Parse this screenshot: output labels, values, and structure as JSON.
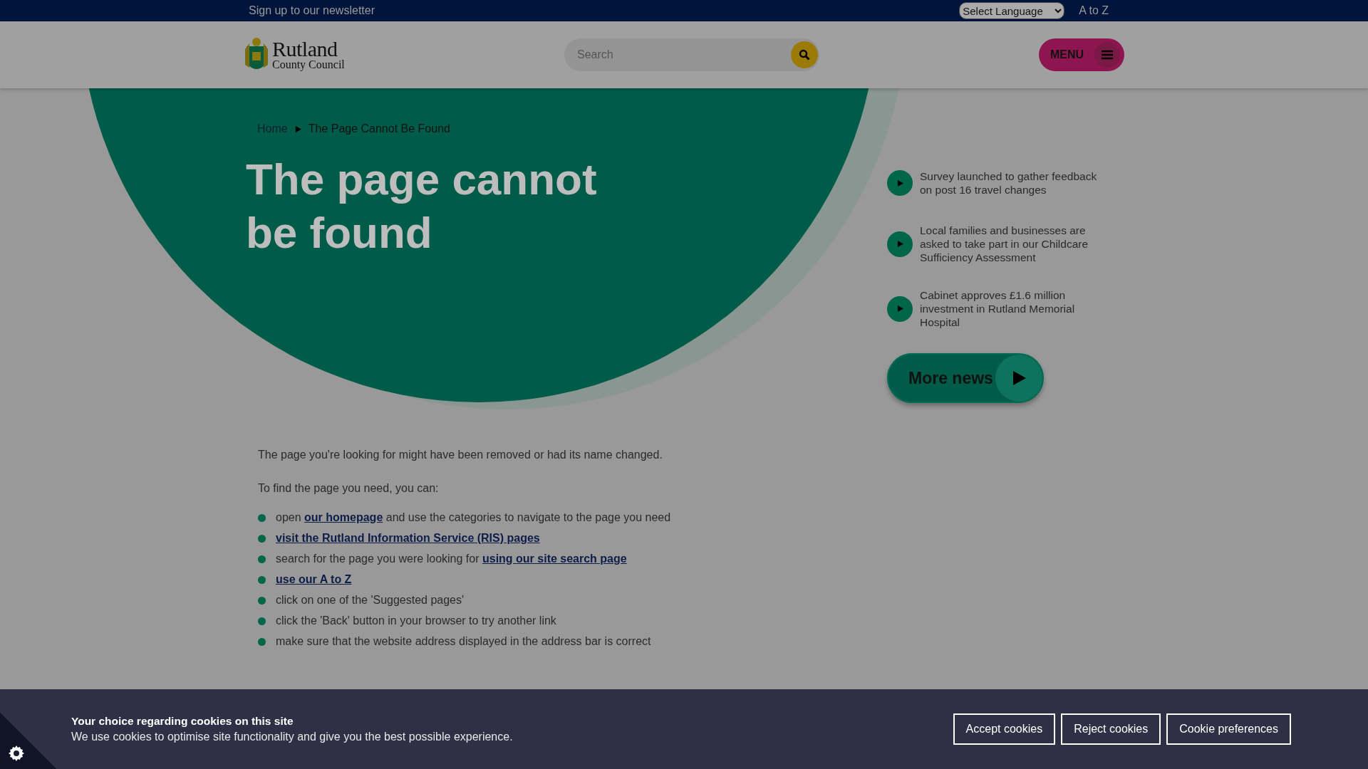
{
  "top_bar": {
    "newsletter_link": "Sign up to our newsletter",
    "language_select": "Select Language",
    "a_to_z_link": "A to Z"
  },
  "header": {
    "logo": {
      "name": "Rutland",
      "subtitle": "County Council"
    },
    "search": {
      "placeholder": "Search"
    },
    "menu_button": "MENU"
  },
  "breadcrumb": [
    {
      "label": "Home",
      "link": true
    },
    {
      "label": "The Page Cannot Be Found",
      "link": false
    }
  ],
  "title": "The page cannot be found",
  "news": [
    {
      "title": "Survey launched to gather feedback on post 16 travel changes"
    },
    {
      "title": "Local families and businesses are asked to take part in our Childcare Sufficiency Assessment"
    },
    {
      "title": "Cabinet approves £1.6 million investment in Rutland Memorial Hospital"
    }
  ],
  "more_news": "More news",
  "content": {
    "paragraphs": [
      "The page you're looking for might have been removed or had its name changed.",
      "To find the page you need, you can:"
    ],
    "list": [
      {
        "segments": [
          {
            "text": "open ",
            "link": false
          },
          {
            "text": "our homepage",
            "link": true
          },
          {
            "text": " and use the categories to navigate to the page you need",
            "link": false
          }
        ]
      },
      {
        "segments": [
          {
            "text": "visit the Rutland Information Service (RIS) pages",
            "link": true
          }
        ]
      },
      {
        "segments": [
          {
            "text": "search for the page you were looking for ",
            "link": false
          },
          {
            "text": "using our site search page",
            "link": true
          }
        ]
      },
      {
        "segments": [
          {
            "text": "use our A to Z",
            "link": true
          }
        ]
      },
      {
        "segments": [
          {
            "text": "click on one of the 'Suggested pages'",
            "link": false
          }
        ]
      },
      {
        "segments": [
          {
            "text": "click the 'Back' button in your browser to try another link",
            "link": false
          }
        ]
      },
      {
        "segments": [
          {
            "text": "make sure that the website address displayed in the address bar is correct",
            "link": false
          }
        ]
      }
    ]
  },
  "cookie_banner": {
    "title": "Your choice regarding cookies on this site",
    "text": "We use cookies to optimise site functionality and give you the best possible experience.",
    "buttons": [
      "Accept cookies",
      "Reject cookies",
      "Cookie preferences"
    ]
  }
}
